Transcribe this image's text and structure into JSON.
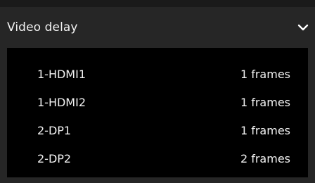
{
  "panel": {
    "title": "Video delay",
    "toggle_icon": "chevron-down-icon",
    "rows": [
      {
        "label": "1-HDMI1",
        "value": "1 frames"
      },
      {
        "label": "1-HDMI2",
        "value": "1 frames"
      },
      {
        "label": "2-DP1",
        "value": "1 frames"
      },
      {
        "label": "2-DP2",
        "value": "2 frames"
      }
    ]
  },
  "colors": {
    "background": "#1a1a1a",
    "header": "#262626",
    "list_background": "#000000",
    "text": "#f2f2f2"
  }
}
